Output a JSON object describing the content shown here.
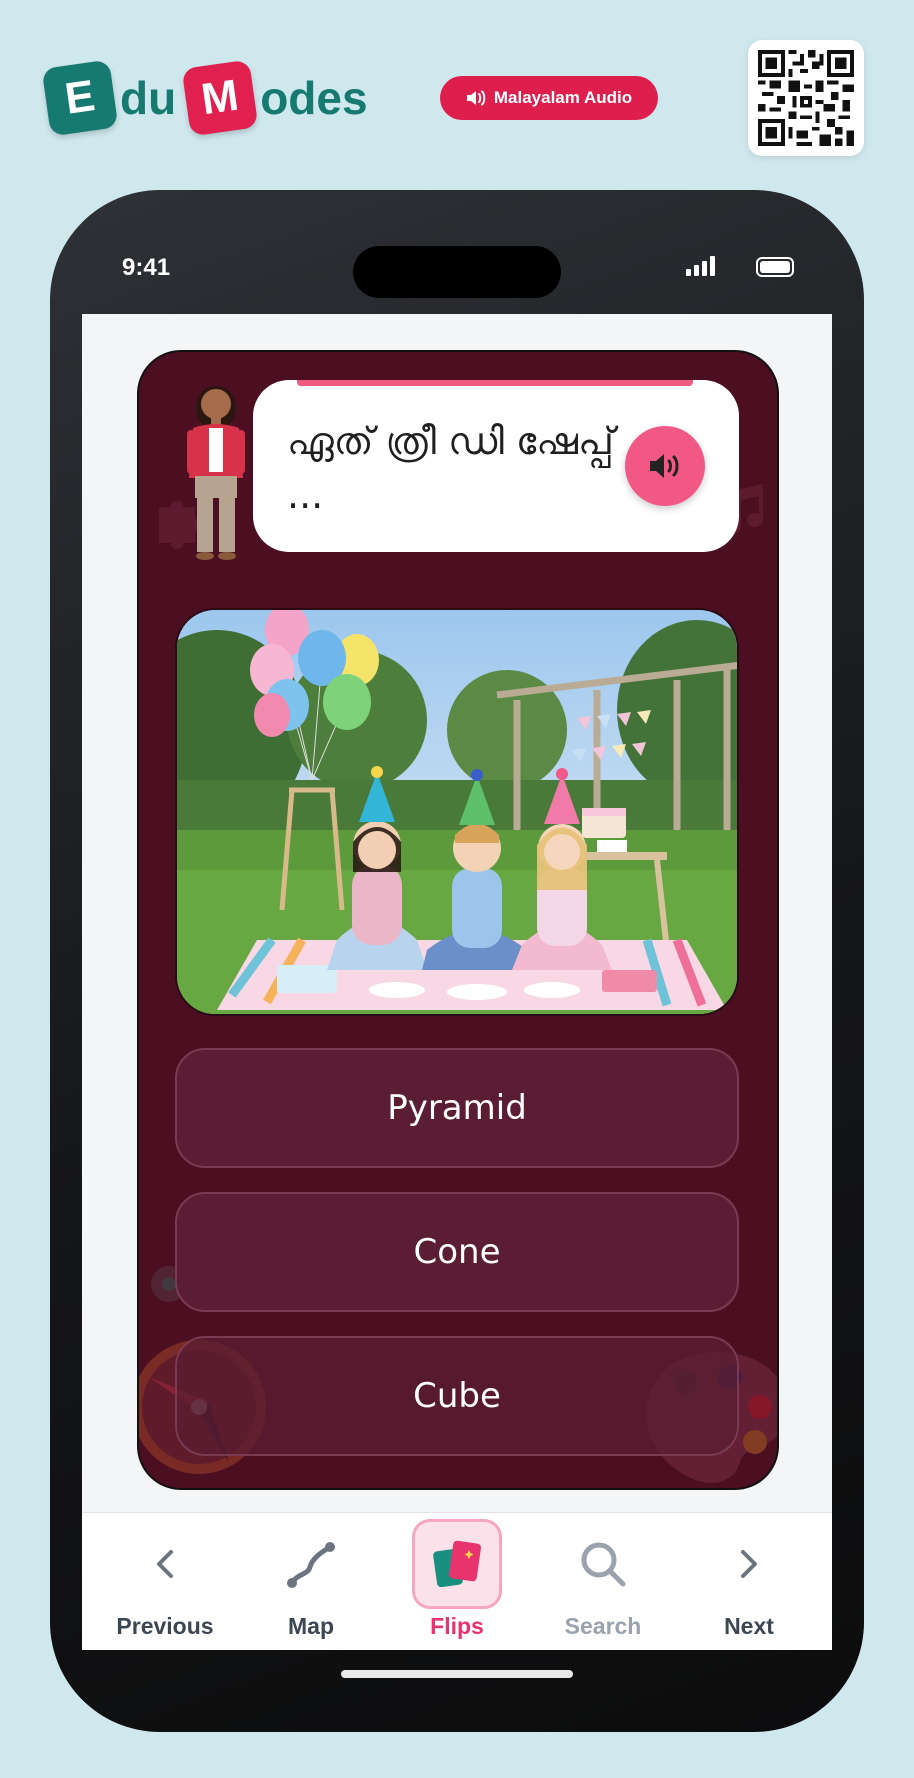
{
  "brand": {
    "tile1": "E",
    "text1": "du",
    "tile2": "M",
    "text2": "odes"
  },
  "audio_button": {
    "label": "Malayalam Audio",
    "icon": "speaker-icon"
  },
  "qr": {
    "icon": "qr-code-icon"
  },
  "status_bar": {
    "time": "9:41"
  },
  "question": {
    "text": "ഏത് ത്രീ ഡി ഷേപ്പ് ...",
    "speak_icon": "speaker-icon"
  },
  "image": {
    "alt": "Children in party hats at a garden birthday picnic"
  },
  "options": [
    {
      "label": "Pyramid"
    },
    {
      "label": "Cone"
    },
    {
      "label": "Cube"
    }
  ],
  "nav": {
    "items": [
      {
        "label": "Previous",
        "icon": "chevron-left-icon"
      },
      {
        "label": "Map",
        "icon": "map-path-icon"
      },
      {
        "label": "Flips",
        "icon": "flip-cards-icon",
        "active": true
      },
      {
        "label": "Search",
        "icon": "search-icon"
      },
      {
        "label": "Next",
        "icon": "chevron-right-icon"
      }
    ]
  },
  "colors": {
    "brand_teal": "#177a70",
    "brand_red": "#e0204f",
    "card_bg": "#4c0f22",
    "option_bg": "#5a1d33",
    "accent_pink": "#f25885",
    "nav_active": "#e8336f"
  }
}
